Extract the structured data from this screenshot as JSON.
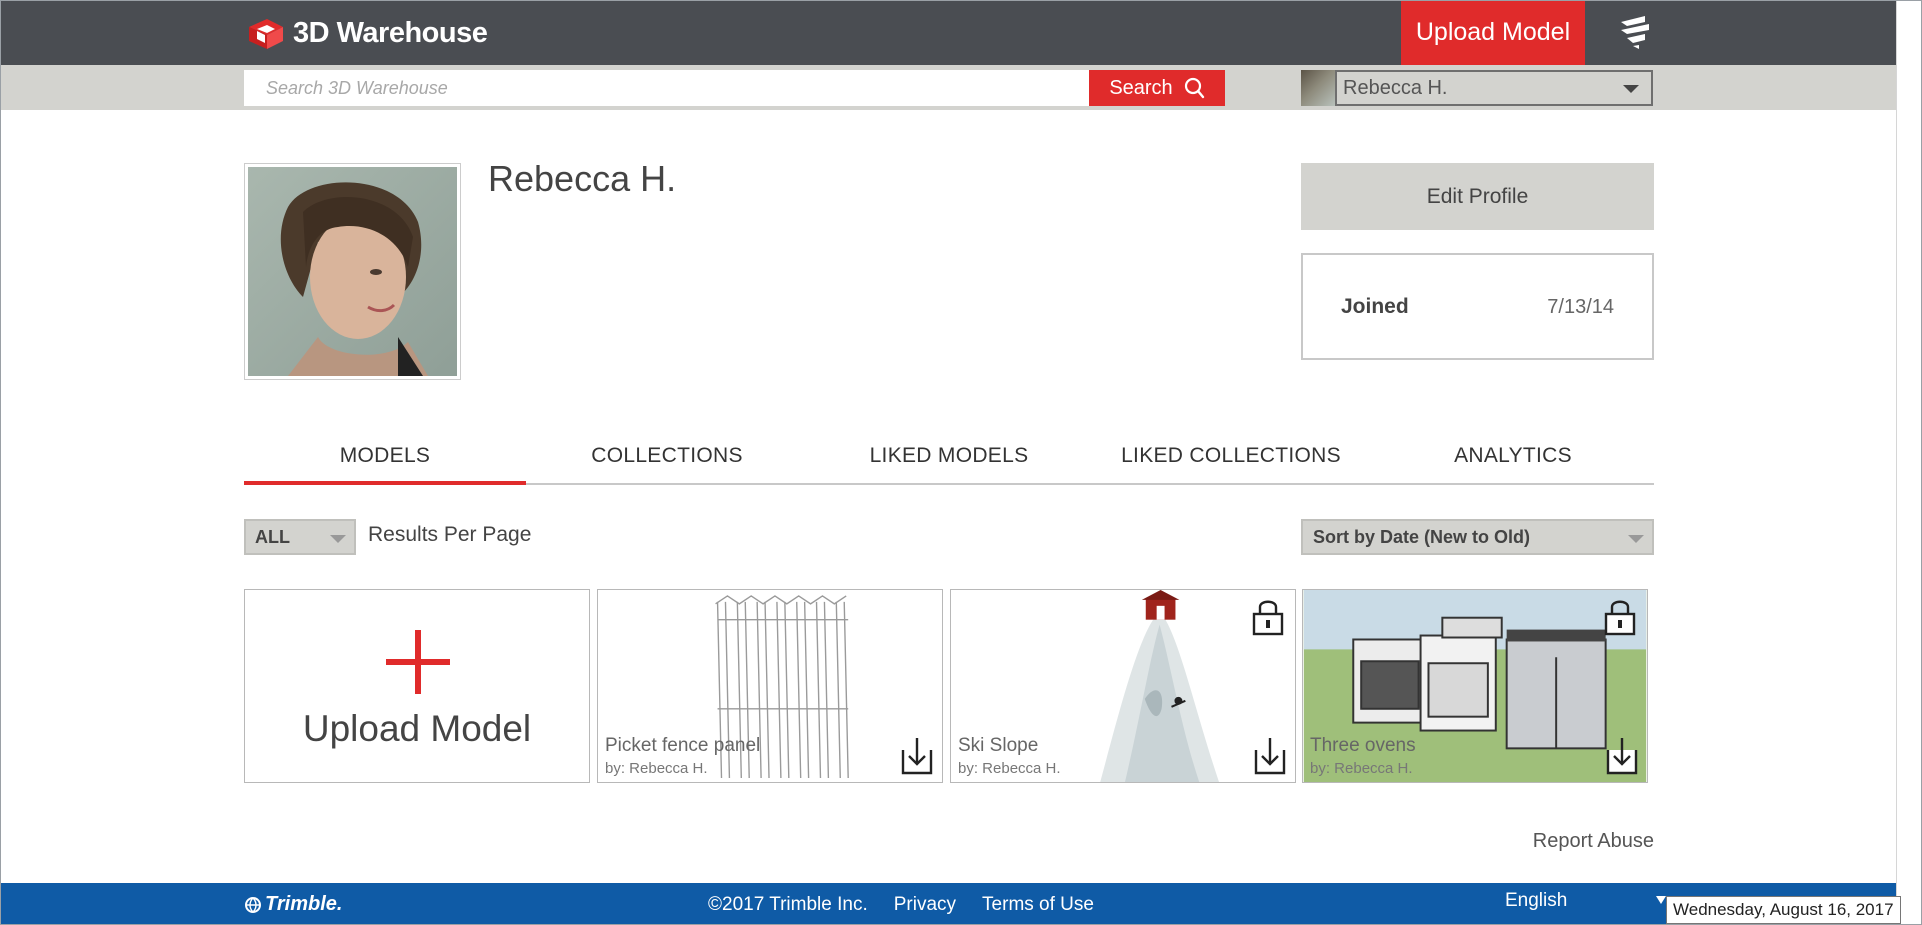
{
  "header": {
    "brand": "3D Warehouse",
    "upload_label": "Upload Model"
  },
  "search": {
    "placeholder": "Search 3D Warehouse",
    "button_label": "Search"
  },
  "user_menu": {
    "name": "Rebecca H."
  },
  "profile": {
    "name": "Rebecca H.",
    "edit_label": "Edit Profile",
    "joined_label": "Joined",
    "joined_date": "7/13/14"
  },
  "tabs": [
    {
      "label": "MODELS",
      "active": true
    },
    {
      "label": "COLLECTIONS",
      "active": false
    },
    {
      "label": "LIKED MODELS",
      "active": false
    },
    {
      "label": "LIKED COLLECTIONS",
      "active": false
    },
    {
      "label": "ANALYTICS",
      "active": false
    }
  ],
  "controls": {
    "per_page_value": "ALL",
    "per_page_label": "Results Per Page",
    "sort_value": "Sort by Date (New to Old)"
  },
  "upload_card": {
    "label": "Upload Model"
  },
  "models": [
    {
      "title": "Picket fence panel",
      "author": "by: Rebecca H.",
      "locked": false
    },
    {
      "title": "Ski Slope",
      "author": "by: Rebecca H.",
      "locked": true
    },
    {
      "title": "Three ovens",
      "author": "by: Rebecca H.",
      "locked": true
    }
  ],
  "report_abuse": "Report Abuse",
  "footer": {
    "brand": "Trimble.",
    "copyright": "©2017 Trimble Inc.",
    "privacy": "Privacy",
    "terms": "Terms of Use",
    "language": "English"
  },
  "tooltip": "Wednesday, August 16, 2017",
  "colors": {
    "accent": "#e02b2b",
    "header_bg": "#4a4d52",
    "footer_bg": "#0f5ba6",
    "control_bg": "#d3d3cf"
  }
}
